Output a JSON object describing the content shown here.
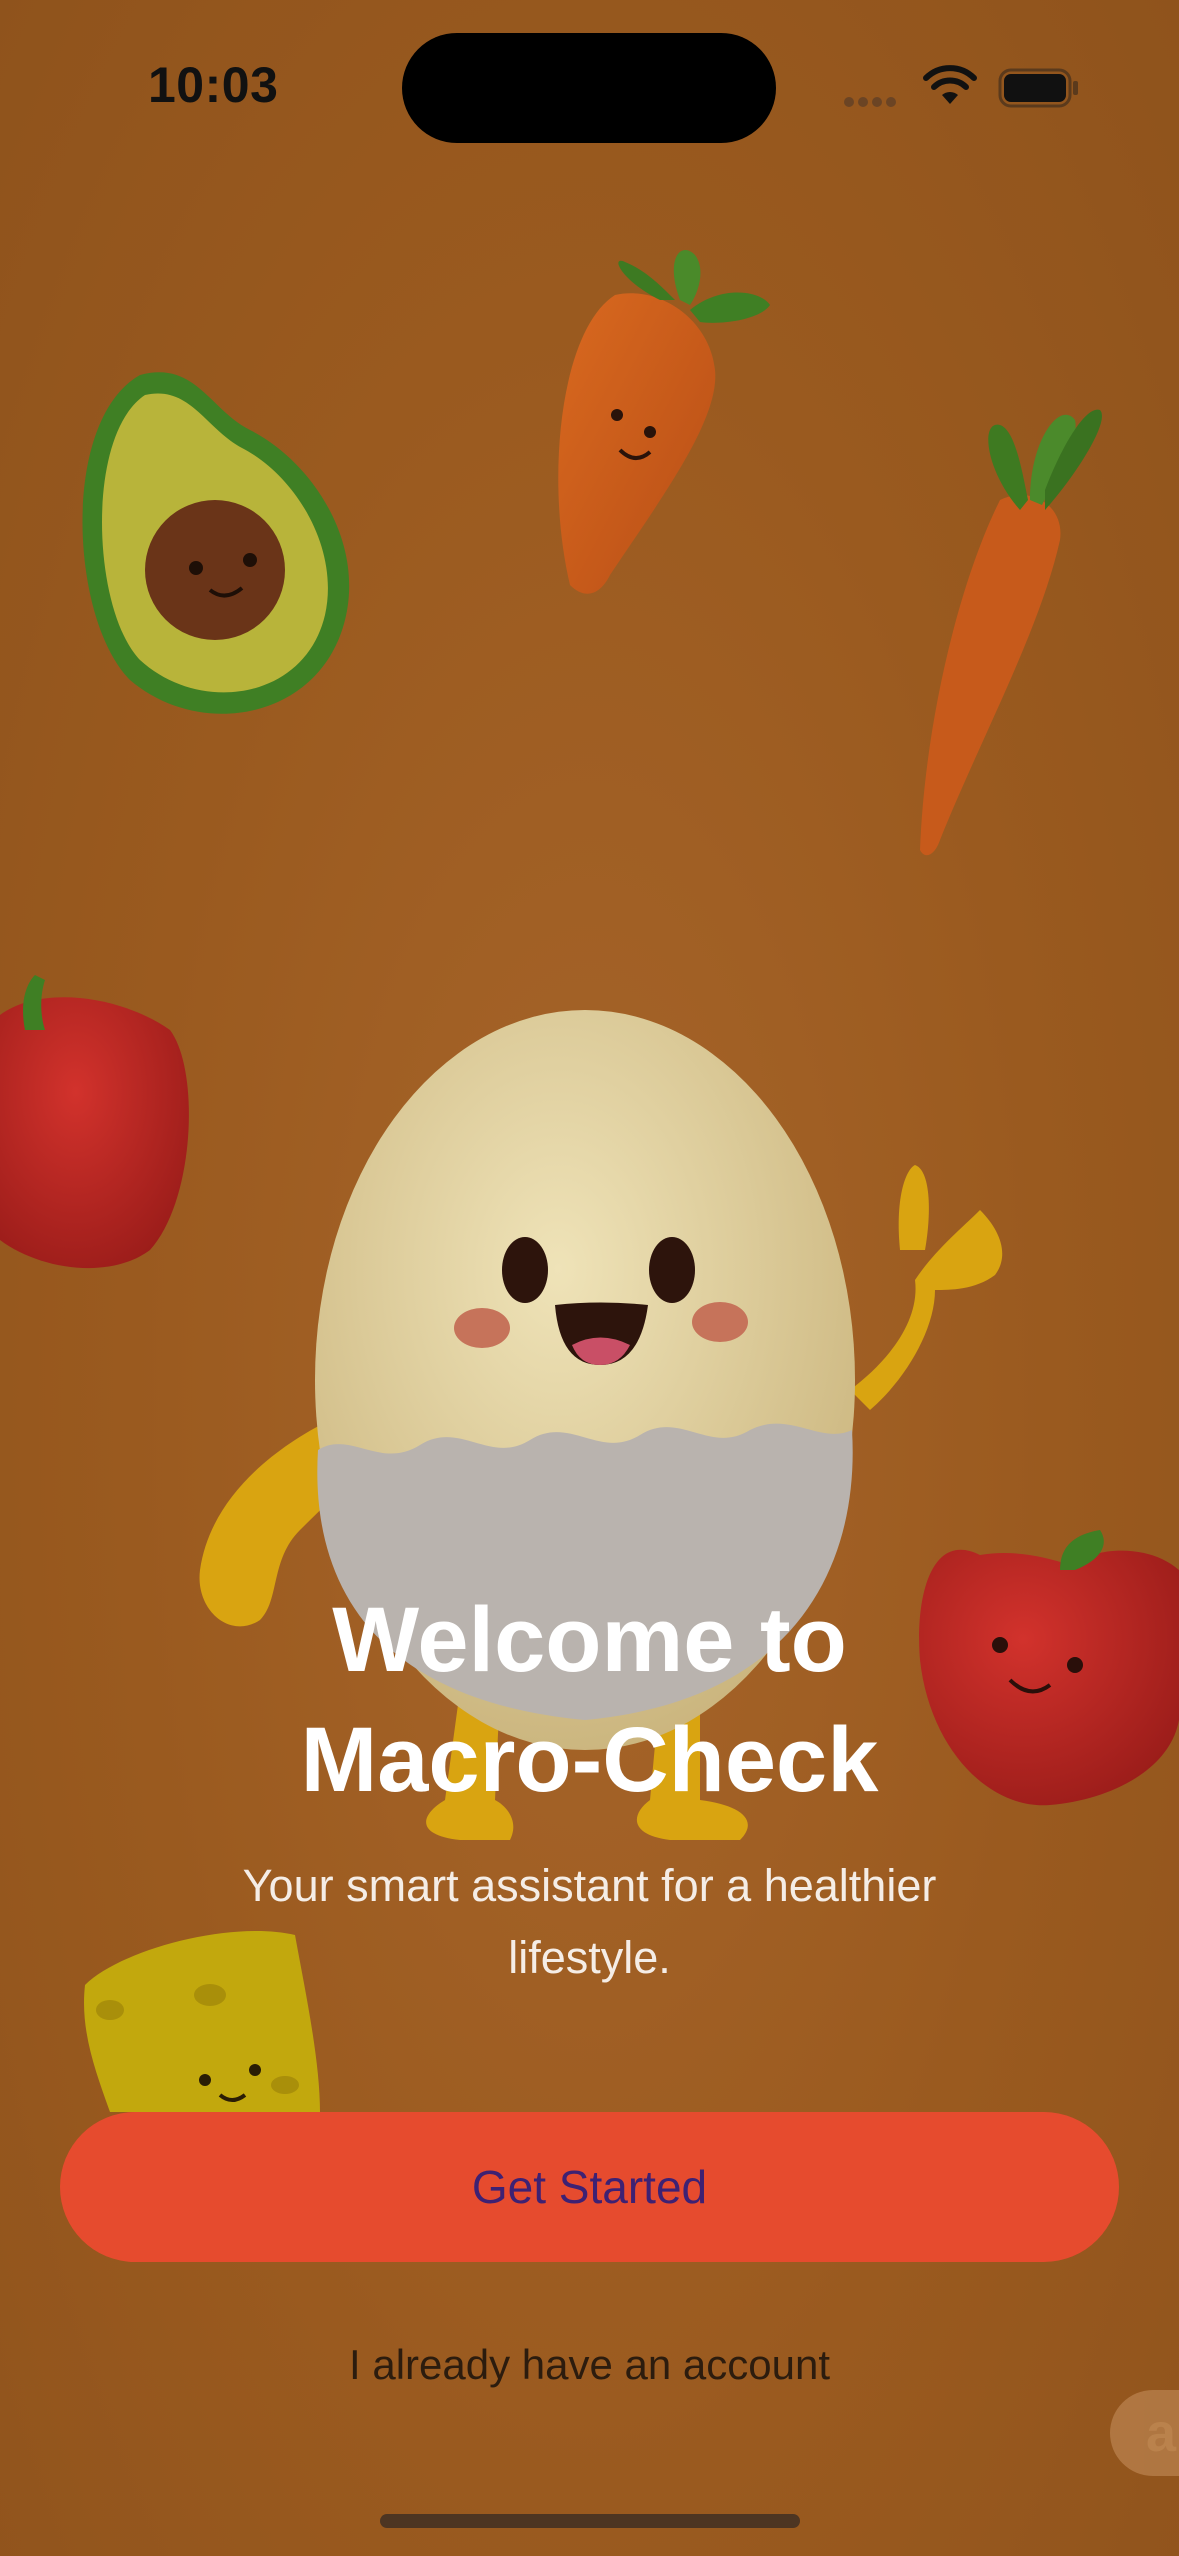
{
  "status_bar": {
    "time": "10:03"
  },
  "illustration": {
    "characters": [
      "egg-mascot",
      "avocado",
      "carrot",
      "carrot",
      "bell-pepper",
      "apple",
      "cheese"
    ]
  },
  "welcome": {
    "title_line1": "Welcome to",
    "title_line2": "Macro-Check",
    "subtitle": "Your smart assistant for a healthier lifestyle."
  },
  "actions": {
    "get_started_label": "Get Started",
    "login_link_label": "I already have an account"
  },
  "floating_chip": {
    "glyph": "a"
  },
  "colors": {
    "background": "#9a5a1f",
    "primary_button": "#e64b2e",
    "primary_button_text": "#3e2173",
    "title_text": "#ffffff"
  },
  "icons": {
    "wifi": "wifi-icon",
    "battery": "battery-icon",
    "cellular": "cellular-signal-icon"
  }
}
